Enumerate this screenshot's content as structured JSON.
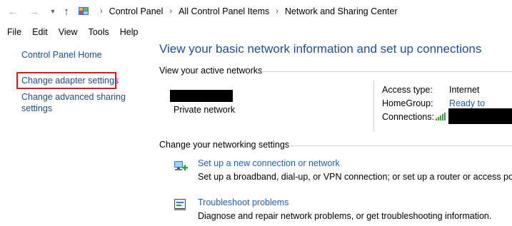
{
  "breadcrumb": [
    "Control Panel",
    "All Control Panel Items",
    "Network and Sharing Center"
  ],
  "menu": [
    "File",
    "Edit",
    "View",
    "Tools",
    "Help"
  ],
  "sidebar": {
    "home": "Control Panel Home",
    "adapter": "Change adapter settings",
    "sharing_line1": "Change advanced sharing",
    "sharing_line2": "settings"
  },
  "main": {
    "title": "View your basic network information and set up connections",
    "active_networks_heading": "View your active networks",
    "network_type": "Private network",
    "access_type_label": "Access type:",
    "access_type_value": "Internet",
    "homegroup_label": "HomeGroup:",
    "homegroup_value": "Ready to create",
    "connections_label": "Connections:",
    "change_settings_heading": "Change your networking settings",
    "tasks": [
      {
        "title": "Set up a new connection or network",
        "desc": "Set up a broadband, dial-up, or VPN connection; or set up a router or access point.",
        "icon": "new-connection-icon"
      },
      {
        "title": "Troubleshoot problems",
        "desc": "Diagnose and repair network problems, or get troubleshooting information.",
        "icon": "troubleshoot-icon"
      }
    ]
  },
  "colors": {
    "link": "#1f5fb8",
    "title": "#1d4f91",
    "highlight": "#e8101a"
  }
}
